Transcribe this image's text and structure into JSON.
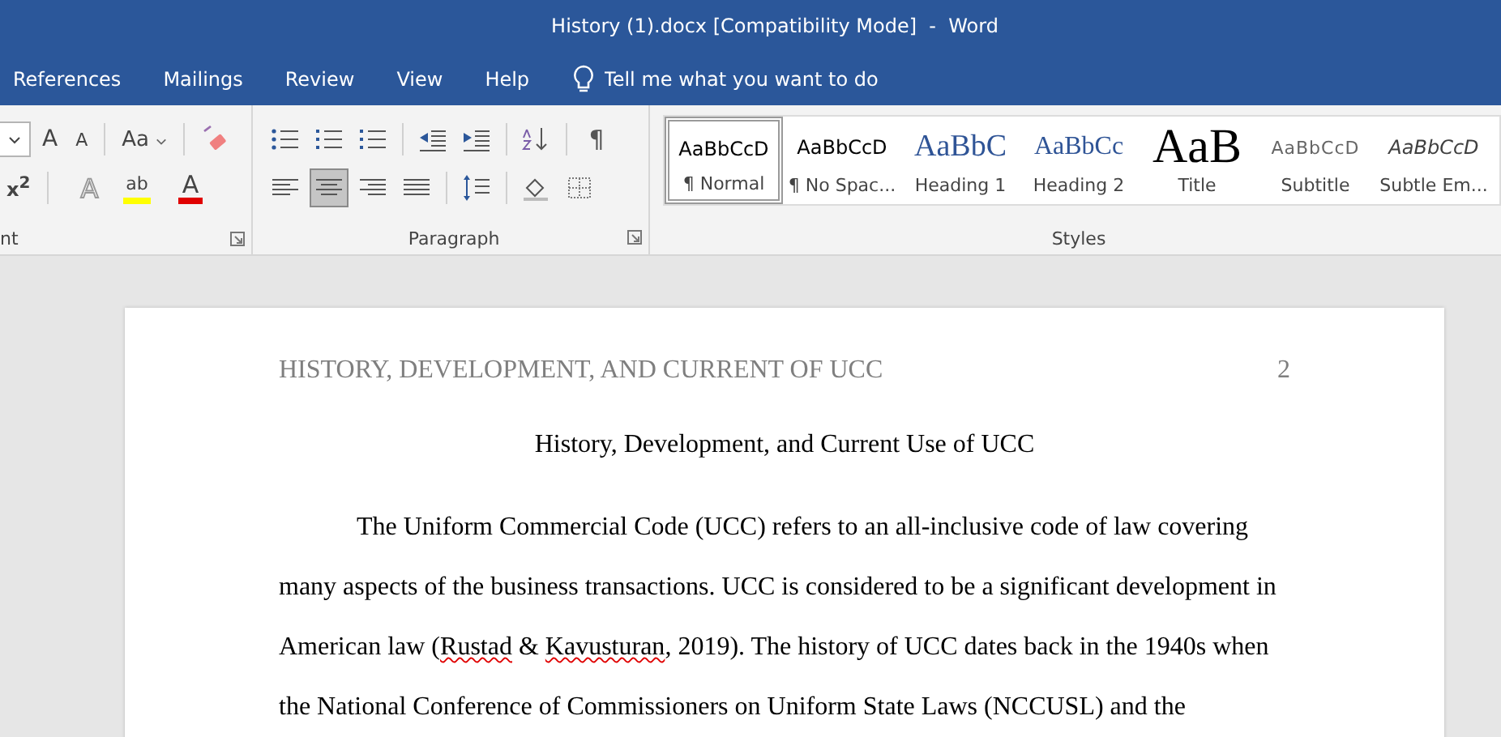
{
  "window": {
    "title": "History (1).docx [Compatibility Mode]  -  Word"
  },
  "tabs": [
    {
      "label": "References"
    },
    {
      "label": "Mailings"
    },
    {
      "label": "Review"
    },
    {
      "label": "View"
    },
    {
      "label": "Help"
    }
  ],
  "tell_me": {
    "placeholder": "Tell me what you want to do"
  },
  "font_group": {
    "label": "nt",
    "row1": [
      {
        "kind": "size"
      },
      {
        "kind": "grow",
        "glyph": "A"
      },
      {
        "kind": "shrink",
        "glyph": "A"
      },
      {
        "kind": "sep"
      },
      {
        "kind": "case",
        "glyph": "Aa"
      },
      {
        "kind": "sep"
      },
      {
        "kind": "clear"
      }
    ],
    "row2": [
      {
        "kind": "super",
        "glyph": "x$^{2}$"
      },
      {
        "kind": "sep"
      },
      {
        "kind": "effects",
        "glyph": "A"
      },
      {
        "kind": "highlight",
        "glyph": "ab",
        "color": "#ffff00"
      },
      {
        "kind": "fontcolor",
        "glyph": "A",
        "color": "#e00000"
      }
    ]
  },
  "paragraph_group": {
    "label": "Paragraph",
    "row1": [
      {
        "kind": "bullets",
        "selected": false
      },
      {
        "kind": "numbering",
        "selected": false
      },
      {
        "kind": "multilevel",
        "selected": false
      },
      {
        "kind": "sep"
      },
      {
        "kind": "outdent",
        "selected": false
      },
      {
        "kind": "indent",
        "selected": false
      },
      {
        "kind": "sep"
      },
      {
        "kind": "sort",
        "selected": false
      },
      {
        "kind": "sep"
      },
      {
        "kind": "pilcrow",
        "glyph": "¶",
        "selected": false
      }
    ],
    "row2": [
      {
        "kind": "left",
        "selected": false
      },
      {
        "kind": "center",
        "selected": true
      },
      {
        "kind": "right",
        "selected": false
      },
      {
        "kind": "justify",
        "selected": false
      },
      {
        "kind": "sep"
      },
      {
        "kind": "spacing",
        "selected": false
      },
      {
        "kind": "sep"
      },
      {
        "kind": "shading",
        "selected": false
      },
      {
        "kind": "borders",
        "selected": false
      }
    ]
  },
  "styles_group": {
    "label": "Styles",
    "items": [
      {
        "kind": "normal",
        "sample": "AaBbCcD",
        "name": "¶ Normal",
        "selected": true
      },
      {
        "kind": "normal",
        "sample": "AaBbCcD",
        "name": "¶ No Spac...",
        "selected": false
      },
      {
        "kind": "heading1",
        "sample": "AaBbC",
        "name": "Heading 1",
        "selected": false
      },
      {
        "kind": "heading2",
        "sample": "AaBbCc",
        "name": "Heading 2",
        "selected": false
      },
      {
        "kind": "title",
        "sample": "AaB",
        "name": "Title",
        "selected": false
      },
      {
        "kind": "subtitle",
        "sample": "AaBbCcD",
        "name": "Subtitle",
        "selected": false
      },
      {
        "kind": "emphasis",
        "sample": "AaBbCcD",
        "name": "Subtle Em...",
        "selected": false
      }
    ]
  },
  "document": {
    "header": "HISTORY, DEVELOPMENT, AND CURRENT OF UCC",
    "page_number": "2",
    "title": "History, Development, and Current Use of UCC",
    "paragraph": [
      {
        "text": "The Uniform Commercial Code (UCC) refers to an all-inclusive code of law covering many aspects of the business transactions. UCC is considered to be a significant development in American law (",
        "misspelled": false
      },
      {
        "text": "Rustad",
        "misspelled": true
      },
      {
        "text": " & ",
        "misspelled": false
      },
      {
        "text": "Kavusturan",
        "misspelled": true
      },
      {
        "text": ", 2019). The history of UCC dates back in the 1940s when the National Conference of Commissioners on Uniform State Laws (NCCUSL) and the",
        "misspelled": false
      }
    ]
  }
}
